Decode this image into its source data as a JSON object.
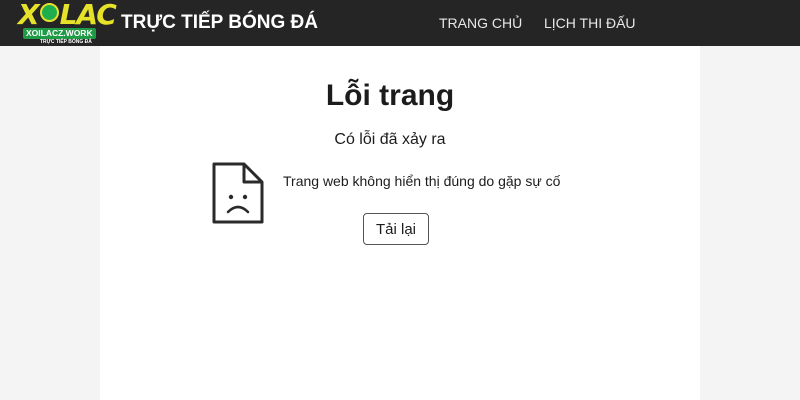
{
  "header": {
    "logo": {
      "wordmark_left": "X",
      "wordmark_right": "LAC",
      "badge": "XOILACZ.WORK",
      "tagline": "TRỰC TIẾP BÓNG ĐÁ"
    },
    "site_title": "TRỰC TIẾP BÓNG ĐÁ",
    "nav": {
      "home": "TRANG CHỦ",
      "schedule": "LỊCH THI ĐẤU"
    }
  },
  "error": {
    "title": "Lỗi trang",
    "subtitle": "Có lỗi đã xảy ra",
    "description": "Trang web không hiển thị đúng do gặp sự cố",
    "icon": "sad-document-icon",
    "reload_label": "Tải lại"
  },
  "colors": {
    "header_bg": "#252525",
    "page_bg": "#f4f4f4",
    "content_bg": "#ffffff",
    "logo_yellow": "#e6e22a",
    "logo_green": "#1f9b46"
  }
}
